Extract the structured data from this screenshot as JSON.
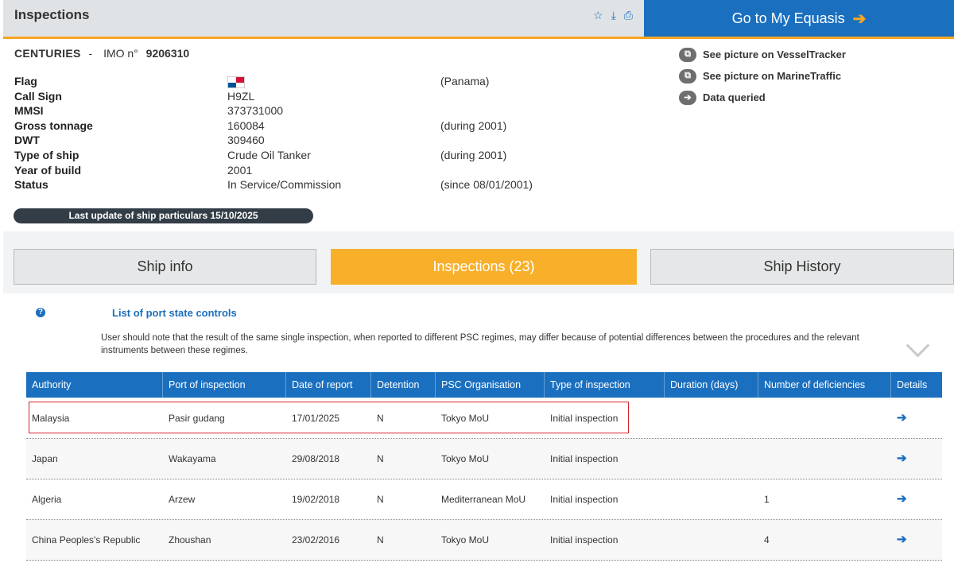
{
  "header": {
    "title": "Inspections",
    "icons": [
      "star-icon",
      "download-icon",
      "print-icon"
    ],
    "go_button": "Go to My Equasis",
    "go_arrow": "➔"
  },
  "ship": {
    "name": "CENTURIES",
    "separator": "-",
    "imo_label": "IMO n°",
    "imo": "9206310",
    "particulars": [
      {
        "label": "Flag",
        "value": "",
        "extra": "(Panama)"
      },
      {
        "label": "Call Sign",
        "value": "H9ZL",
        "extra": ""
      },
      {
        "label": "MMSI",
        "value": "373731000",
        "extra": ""
      },
      {
        "label": "Gross tonnage",
        "value": "160084",
        "extra": "(during 2001)"
      },
      {
        "label": "DWT",
        "value": "309460",
        "extra": ""
      },
      {
        "label": "Type of ship",
        "value": "Crude Oil Tanker",
        "extra": "(during 2001)"
      },
      {
        "label": "Year of build",
        "value": "2001",
        "extra": ""
      },
      {
        "label": "Status",
        "value": "In Service/Commission",
        "extra": "(since 08/01/2001)"
      }
    ],
    "last_update": "Last update of ship particulars 15/10/2025"
  },
  "links": [
    {
      "icon": "external-link-icon",
      "label": "See picture on VesselTracker"
    },
    {
      "icon": "external-link-icon",
      "label": "See picture on MarineTraffic"
    },
    {
      "icon": "arrow-right-icon",
      "label": "Data queried"
    }
  ],
  "tabs": [
    {
      "label": "Ship info",
      "active": false
    },
    {
      "label": "Inspections (23)",
      "active": true
    },
    {
      "label": "Ship History",
      "active": false
    }
  ],
  "list": {
    "title": "List of port state controls",
    "note": "User should note that the result of the same single inspection, when reported to different PSC regimes, may differ because of potential differences between the procedures and the relevant instruments between these regimes."
  },
  "table": {
    "columns": [
      "Authority",
      "Port of inspection",
      "Date of report",
      "Detention",
      "PSC Organisation",
      "Type of inspection",
      "Duration (days)",
      "Number of deficiencies",
      "Details"
    ],
    "rows": [
      [
        "Malaysia",
        "Pasir gudang",
        "17/01/2025",
        "N",
        "Tokyo MoU",
        "Initial inspection",
        "",
        "",
        "➔"
      ],
      [
        "Japan",
        "Wakayama",
        "29/08/2018",
        "N",
        "Tokyo MoU",
        "Initial inspection",
        "",
        "",
        "➔"
      ],
      [
        "Algeria",
        "Arzew",
        "19/02/2018",
        "N",
        "Mediterranean MoU",
        "Initial inspection",
        "",
        "1",
        "➔"
      ],
      [
        "China Peoples's Republic",
        "Zhoushan",
        "23/02/2016",
        "N",
        "Tokyo MoU",
        "Initial inspection",
        "",
        "4",
        "➔"
      ]
    ]
  },
  "colors": {
    "header_blue": "#1a6fbf",
    "accent_orange": "#f8b02b",
    "highlight_red": "#d9232d"
  }
}
